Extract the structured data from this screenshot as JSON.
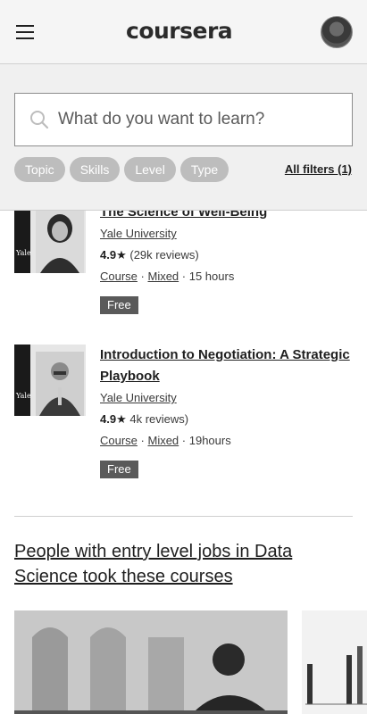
{
  "header": {
    "logo_text": "coursera",
    "menu_icon": "hamburger-menu-icon",
    "avatar_icon": "user-avatar"
  },
  "search": {
    "placeholder": "What do you want to learn?",
    "icon": "search-icon"
  },
  "filters": {
    "chips": [
      "Topic",
      "Skills",
      "Level",
      "Type"
    ],
    "all_filters_label": "All filters (1)"
  },
  "courses": [
    {
      "title": "The Science of Well-Being",
      "partner": "Yale University",
      "rating": "4.9★",
      "reviews": "(29k reviews)",
      "type": "Course",
      "level": "Mixed",
      "duration": "· 15 hours",
      "badge": "Free",
      "logo_text": "Yale"
    },
    {
      "title": "Introduction to Negotiation: A Strategic Playbook",
      "partner": "Yale University",
      "rating": "4.9★",
      "reviews": "4k reviews)",
      "type": "Course",
      "level": "Mixed",
      "duration": "· 19hours",
      "badge": "Free",
      "logo_text": "Yale"
    }
  ],
  "section": {
    "title": "People with entry level jobs in Data Science took these courses"
  },
  "colors": {
    "chip_bg": "#bdbdbd",
    "badge_bg": "#5a5a5a",
    "header_bg": "#f5f5f5"
  }
}
